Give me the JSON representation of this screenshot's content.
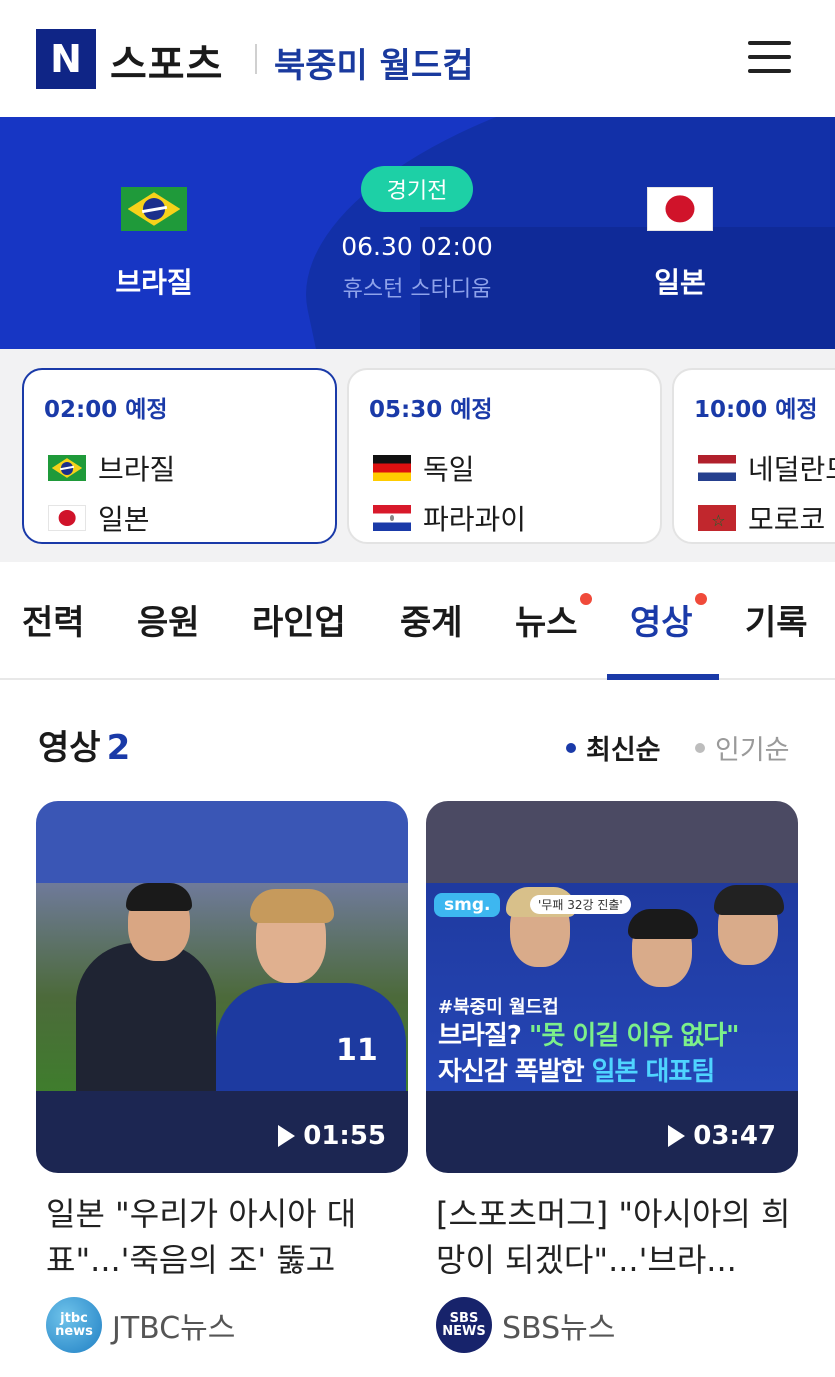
{
  "header": {
    "logo_letter": "N",
    "logo_text": "스포츠",
    "event_title": "북중미 월드컵"
  },
  "match": {
    "status": "경기전",
    "home": {
      "name": "브라질"
    },
    "away": {
      "name": "일본"
    },
    "datetime": "06.30 02:00",
    "stadium": "휴스턴 스타디움"
  },
  "schedule": [
    {
      "time": "02:00 예정",
      "team1": "브라질",
      "team2": "일본",
      "active": true
    },
    {
      "time": "05:30 예정",
      "team1": "독일",
      "team2": "파라과이",
      "active": false
    },
    {
      "time": "10:00 예정",
      "team1": "네덜란드",
      "team2": "모로코",
      "active": false
    }
  ],
  "tabs": [
    {
      "label": "전력",
      "dot": false,
      "active": false
    },
    {
      "label": "응원",
      "dot": false,
      "active": false
    },
    {
      "label": "라인업",
      "dot": false,
      "active": false
    },
    {
      "label": "중계",
      "dot": false,
      "active": false
    },
    {
      "label": "뉴스",
      "dot": true,
      "active": false
    },
    {
      "label": "영상",
      "dot": true,
      "active": true
    },
    {
      "label": "기록",
      "dot": false,
      "active": false
    }
  ],
  "videos_section": {
    "title": "영상",
    "count": "2",
    "sort_latest": "최신순",
    "sort_popular": "인기순"
  },
  "videos": [
    {
      "duration": "01:55",
      "title": "일본 \"우리가 아시아 대표\"...'죽음의 조' 뚫고 브...",
      "source": "JTBC뉴스",
      "source_logo": "jtbc news",
      "jersey_number": "11"
    },
    {
      "duration": "03:47",
      "title": "[스포츠머그] \"아시아의 희망이 되겠다\"...'브라...",
      "source": "SBS뉴스",
      "source_logo": "SBS NEWS",
      "badge": "smg.",
      "badge_sub": "'무패 32강 진출'",
      "caption_tag": "#북중미 월드컵",
      "caption_line1_a": "브라질? ",
      "caption_line1_b": "\"못 이길 이유 없다\"",
      "caption_line2_a": "자신감 폭발한 ",
      "caption_line2_b": "일본 대표팀"
    }
  ],
  "colors": {
    "brand": "#0f2586",
    "accent": "#1a3aa8",
    "status": "#1dd0a6",
    "notify_dot": "#f04a3a"
  }
}
